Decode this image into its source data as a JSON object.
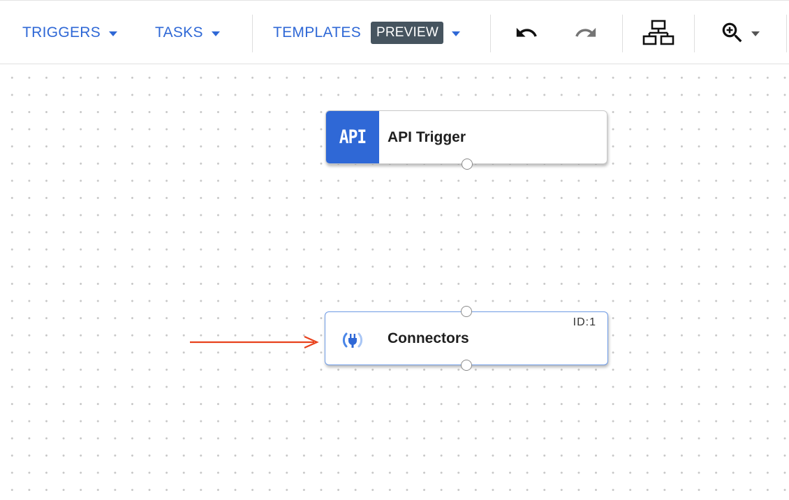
{
  "toolbar": {
    "triggers_label": "TRIGGERS",
    "tasks_label": "TASKS",
    "templates_label": "TEMPLATES",
    "preview_badge": "PREVIEW",
    "icons": [
      "undo-icon",
      "redo-icon",
      "auto-layout-icon",
      "zoom-in-icon"
    ]
  },
  "canvas": {
    "nodes": [
      {
        "kind": "trigger",
        "badge": "API",
        "title": "API Trigger"
      },
      {
        "kind": "task",
        "title": "Connectors",
        "id_label": "ID:1",
        "icon": "plug-icon"
      }
    ],
    "annotation": "red-arrow-pointing-to-connectors"
  },
  "colors": {
    "accent": "#2f68d6",
    "badge_bg": "#46545f",
    "selected_border": "#6e9be6",
    "annotation_arrow": "#e8411c"
  }
}
